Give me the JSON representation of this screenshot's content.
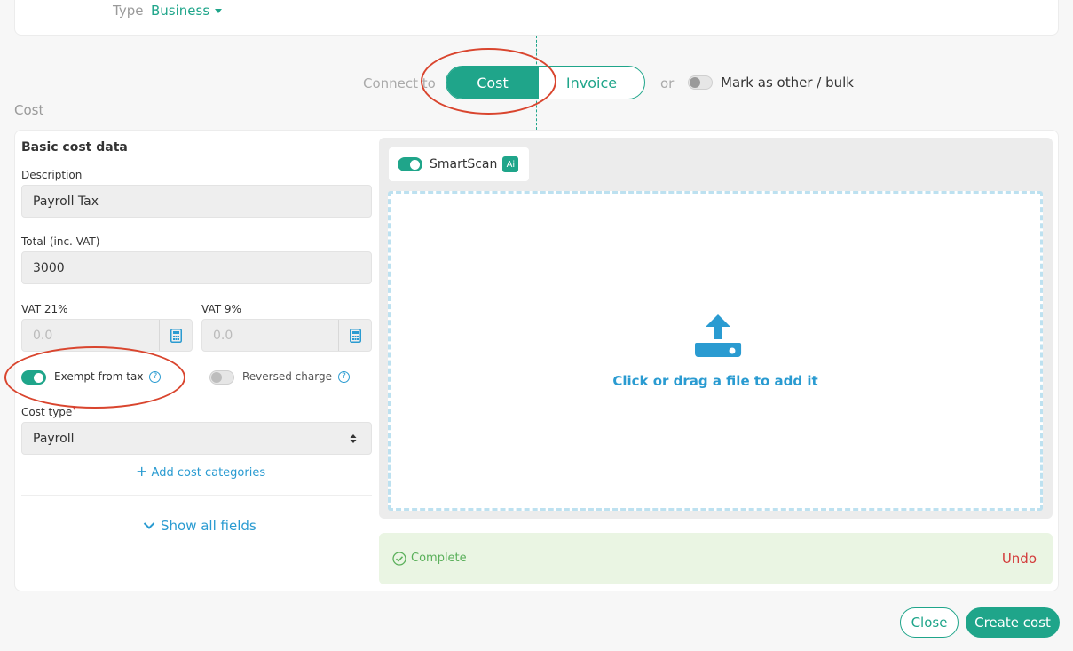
{
  "header": {
    "type_label": "Type",
    "type_value": "Business"
  },
  "connect": {
    "label": "Connect to",
    "options": [
      "Cost",
      "Invoice"
    ],
    "selected": "Cost",
    "or_label": "or",
    "bulk_label": "Mark as other / bulk",
    "bulk_enabled": false
  },
  "section_title": "Cost",
  "form": {
    "heading": "Basic cost data",
    "description_label": "Description",
    "description_value": "Payroll Tax",
    "total_label": "Total (inc. VAT)",
    "total_value": "3000",
    "vat21_label": "VAT 21%",
    "vat21_placeholder": "0.0",
    "vat9_label": "VAT 9%",
    "vat9_placeholder": "0.0",
    "exempt_label": "Exempt from tax",
    "exempt_enabled": true,
    "reversed_label": "Reversed charge",
    "reversed_enabled": false,
    "cost_type_label": "Cost type",
    "cost_type_required": "*",
    "cost_type_value": "Payroll",
    "add_categories_label": "Add cost categories",
    "show_all_label": "Show all fields"
  },
  "smartscan": {
    "label": "SmartScan",
    "badge": "Ai",
    "enabled": true
  },
  "upload": {
    "text": "Click or drag a file to add it"
  },
  "status": {
    "text": "Complete",
    "undo_label": "Undo"
  },
  "actions": {
    "close_label": "Close",
    "create_label": "Create cost"
  },
  "colors": {
    "accent": "#1fa58a",
    "link": "#2a9bd1",
    "annotation": "#d9452e",
    "danger": "#d33a3a",
    "success_bg": "#eaf5e3"
  }
}
